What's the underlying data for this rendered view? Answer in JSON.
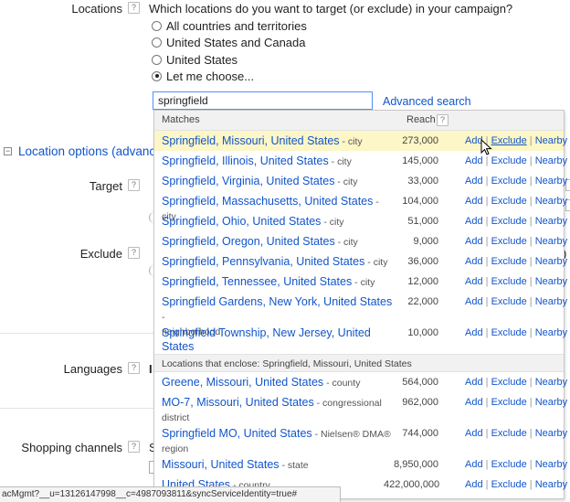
{
  "form": {
    "locations_label": "Locations",
    "question": "Which locations do you want to target (or exclude) in your campaign?",
    "help_glyph": "?",
    "radio_options": [
      {
        "label": "All countries and territories",
        "checked": false
      },
      {
        "label": "United States and Canada",
        "checked": false
      },
      {
        "label": "United States",
        "checked": false
      },
      {
        "label": "Let me choose...",
        "checked": true
      }
    ],
    "search_value": "springfield",
    "advanced_search": "Advanced search",
    "location_options": "Location options (advance",
    "target_label": "Target",
    "exclude_label": "Exclude",
    "languages_label": "Languages",
    "shopping_label": "Shopping channels"
  },
  "dropdown": {
    "col_matches": "Matches",
    "col_reach": "Reach",
    "actions": {
      "add": "Add",
      "exclude": "Exclude",
      "nearby": "Nearby",
      "sep": "|"
    },
    "matches": [
      {
        "name": "Springfield, Missouri, United States",
        "type": "- city",
        "reach": "273,000",
        "highlight": true
      },
      {
        "name": "Springfield, Illinois, United States",
        "type": "- city",
        "reach": "145,000"
      },
      {
        "name": "Springfield, Virginia, United States",
        "type": "- city",
        "reach": "33,000"
      },
      {
        "name": "Springfield, Massachusetts, United States",
        "type": "- city",
        "reach": "104,000"
      },
      {
        "name": "Springfield, Ohio, United States",
        "type": "- city",
        "reach": "51,000"
      },
      {
        "name": "Springfield, Oregon, United States",
        "type": "- city",
        "reach": "9,000"
      },
      {
        "name": "Springfield, Pennsylvania, United States",
        "type": "- city",
        "reach": "36,000"
      },
      {
        "name": "Springfield, Tennessee, United States",
        "type": "- city",
        "reach": "12,000"
      },
      {
        "name": "Springfield Gardens, New York, United States",
        "type": "-",
        "type2": "neighborhood",
        "reach": "22,000"
      },
      {
        "name": "Springfield Township, New Jersey, United States",
        "type": "",
        "type2": "- city",
        "reach": "10,000"
      }
    ],
    "enclose_header": "Locations that enclose: Springfield, Missouri, United States",
    "enclosing": [
      {
        "name": "Greene, Missouri, United States",
        "type": "- county",
        "reach": "564,000"
      },
      {
        "name": "MO-7, Missouri, United States",
        "type": "- congressional",
        "type2": "district",
        "reach": "962,000"
      },
      {
        "name": "Springfield MO, United States",
        "type": "- Nielsen® DMA®",
        "type2": "region",
        "reach": "744,000"
      },
      {
        "name": "Missouri, United States",
        "type": "- state",
        "reach": "8,950,000"
      },
      {
        "name": "United States",
        "type": "- country",
        "reach": "422,000,000"
      }
    ]
  },
  "partial": {
    "target_tail": ")",
    "shopping_s": "S",
    "languages_l": "I"
  },
  "statusbar": "acMgmt?__u=13126147998__c=4987093811&syncServiceIdentity=true#"
}
